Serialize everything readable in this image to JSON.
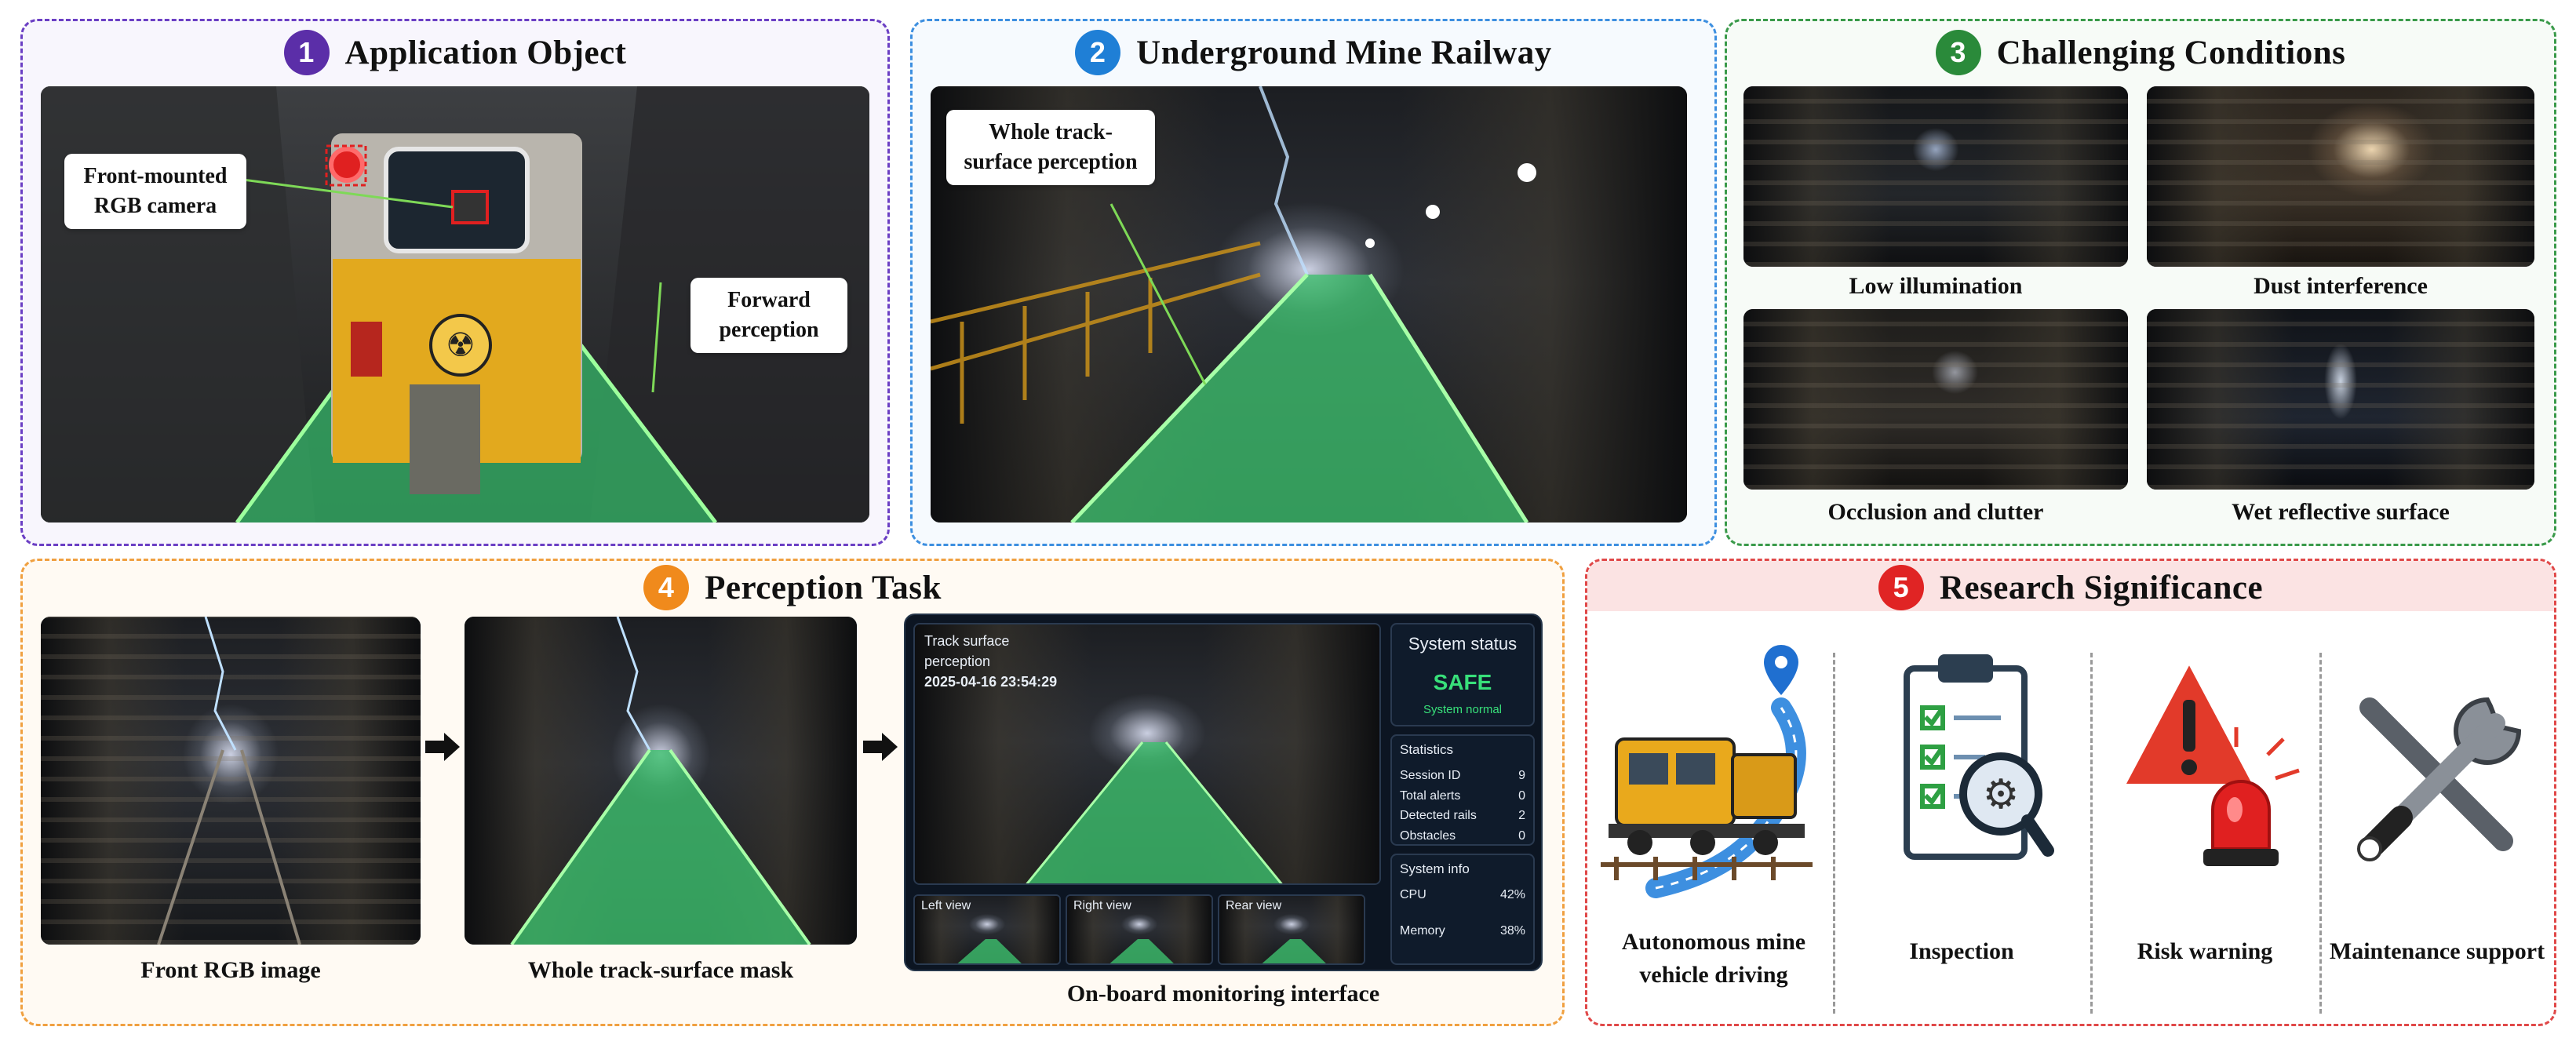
{
  "panel1": {
    "number": "1",
    "title": "Application Object",
    "label_camera": "Front-mounted RGB camera",
    "label_forward": "Forward perception",
    "color": "#5b2ea8"
  },
  "panel2": {
    "number": "2",
    "title": "Underground Mine Railway",
    "label_track": "Whole track-surface perception",
    "color": "#1f7fd6"
  },
  "panel3": {
    "number": "3",
    "title": "Challenging Conditions",
    "color": "#2a8a3a",
    "conditions": [
      "Low illumination",
      "Dust interference",
      "Occlusion and clutter",
      "Wet reflective surface"
    ]
  },
  "panel4": {
    "number": "4",
    "title": "Perception Task",
    "color": "#f08a1c",
    "captions": [
      "Front RGB image",
      "Whole track-surface mask",
      "On-board monitoring interface"
    ],
    "ui": {
      "main_title_line1": "Track surface",
      "main_title_line2": "perception",
      "timestamp": "2025-04-16 23:54:29",
      "status_heading": "System status",
      "status_value": "SAFE",
      "status_note": "System normal",
      "stats_heading": "Statistics",
      "stats": [
        {
          "label": "Session ID",
          "value": "9"
        },
        {
          "label": "Total alerts",
          "value": "0"
        },
        {
          "label": "Detected rails",
          "value": "2"
        },
        {
          "label": "Obstacles",
          "value": "0"
        }
      ],
      "info_heading": "System info",
      "cpu_label": "CPU",
      "cpu_value": "42%",
      "mem_label": "Memory",
      "mem_value": "38%",
      "views": [
        "Left view",
        "Right view",
        "Rear view"
      ]
    }
  },
  "panel5": {
    "number": "5",
    "title": "Research Significance",
    "color": "#e02424",
    "items": [
      "Autonomous mine vehicle driving",
      "Inspection",
      "Risk warning",
      "Maintenance support"
    ]
  }
}
